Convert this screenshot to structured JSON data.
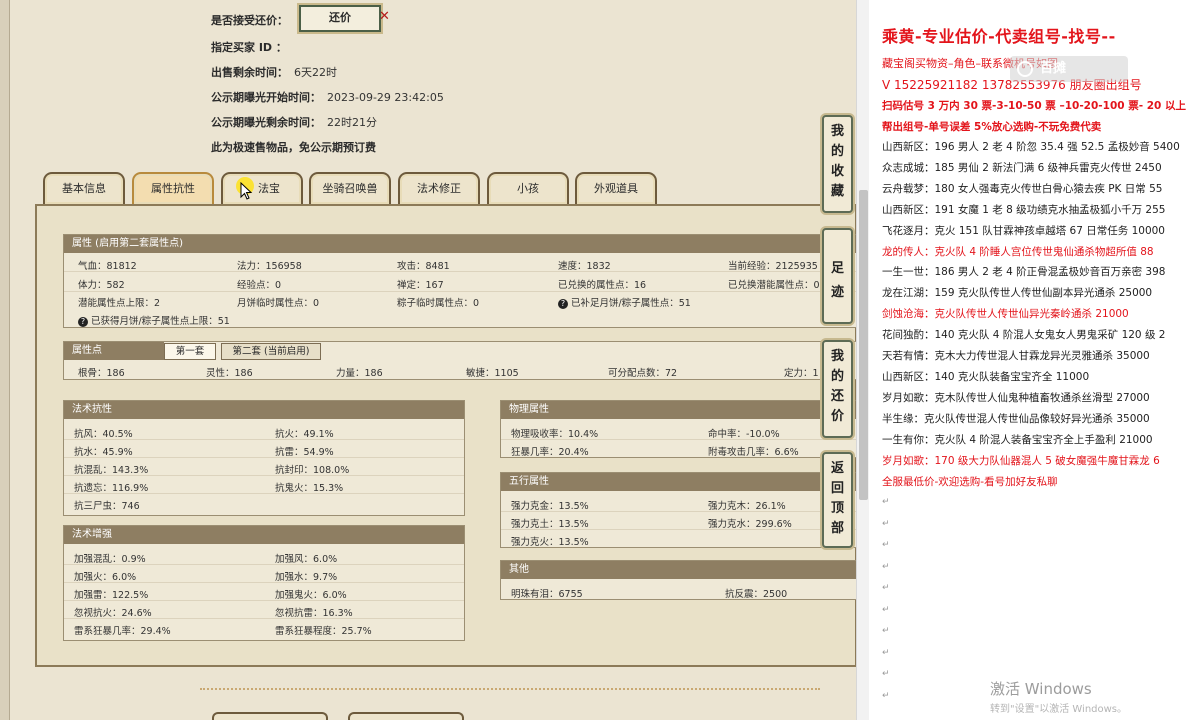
{
  "info": {
    "accept_label": "是否接受还价：",
    "counter_button": "还价",
    "buyer_label": "指定买家 ID ：",
    "remain_label": "出售剩余时间：",
    "remain_value": "6天22时",
    "pub_start_label": "公示期曝光开始时间：",
    "pub_start_value": "2023-09-29 23:42:05",
    "pub_remain_label": "公示期曝光剩余时间：",
    "pub_remain_value": "22时21分",
    "note": "此为极速售物品，免公示期预订费"
  },
  "tabs": [
    "基本信息",
    "属性抗性",
    "法宝",
    "坐骑召唤兽",
    "法术修正",
    "小孩",
    "外观道具"
  ],
  "attr": {
    "header": "属性 (启用第二套属性点)",
    "r1": [
      "气血：81812",
      "法力：156958",
      "攻击：8481",
      "速度：1832",
      "当前经验：2125935"
    ],
    "r2": [
      "体力：582",
      "经验点：0",
      "禅定：167",
      "已兑换的属性点：16",
      "已兑换潜能属性点：0"
    ],
    "r3": [
      "潜能属性点上限：2",
      "月饼临时属性点：0",
      "粽子临时属性点：0",
      "已补足月饼/粽子属性点：51"
    ],
    "r4": "已获得月饼/粽子属性点上限：51"
  },
  "points": {
    "header": "属性点",
    "tab1": "第一套",
    "tab2": "第二套 (当前启用)",
    "row": [
      "根骨：186",
      "灵性：186",
      "力量：186",
      "敏捷：1105",
      "可分配点数：72",
      "定力：1"
    ]
  },
  "spell_res": {
    "header": "法术抗性",
    "cells": [
      [
        "抗风：40.5%",
        "抗火：49.1%"
      ],
      [
        "抗水：45.9%",
        "抗雷：54.9%"
      ],
      [
        "抗混乱：143.3%",
        "抗封印：108.0%"
      ],
      [
        "抗遗忘：116.9%",
        "抗鬼火：15.3%"
      ],
      [
        "抗三尸虫：746",
        ""
      ]
    ]
  },
  "spell_boost": {
    "header": "法术增强",
    "cells": [
      [
        "加强混乱：0.9%",
        "加强风：6.0%"
      ],
      [
        "加强火：6.0%",
        "加强水：9.7%"
      ],
      [
        "加强雷：122.5%",
        "加强鬼火：6.0%"
      ],
      [
        "忽视抗火：24.6%",
        "忽视抗雷：16.3%"
      ],
      [
        "雷系狂暴几率：29.4%",
        "雷系狂暴程度：25.7%"
      ]
    ]
  },
  "physical": {
    "header": "物理属性",
    "cells": [
      [
        "物理吸收率：10.4%",
        "命中率：-10.0%"
      ],
      [
        "狂暴几率：20.4%",
        "附毒攻击几率：6.6%"
      ]
    ]
  },
  "five": {
    "header": "五行属性",
    "cells": [
      [
        "强力克金：13.5%",
        "强力克木：26.1%"
      ],
      [
        "强力克土：13.5%",
        "强力克水：299.6%"
      ],
      [
        "强力克火：13.5%",
        ""
      ]
    ]
  },
  "other": {
    "header": "其他",
    "cells": [
      [
        "明珠有泪：6755",
        "抗反震：2500"
      ]
    ]
  },
  "side_buttons": [
    "我的收藏",
    "足迹",
    "我的还价",
    "返回顶部"
  ],
  "doc": {
    "title": "乘黄-专业估价-代卖组号-找号--",
    "l1": "藏宝阁买物资–角色–联系微机号如图–",
    "l2": "V 15225921182   13782553976 朋友圈出组号",
    "l3": "扫码估号 3 万内 30 票-3-10-50 票 –10-20-100 票- 20 以上",
    "l4": "帮出组号-单号误差 5%放心选购-不玩免费代卖",
    "lines": [
      {
        "t": "山西新区：196 男人 2 老 4 阶忽 35.4 强 52.5 孟极妙音 5400",
        "red": false
      },
      {
        "t": "众志成城：185 男仙 2 新法门满 6 级神兵雷克火传世 2450",
        "red": false
      },
      {
        "t": "云舟载梦：180 女人强毒克火传世白骨心猿去疾 PK 日常 55",
        "red": false
      },
      {
        "t": "山西新区：191 女魔 1 老 8 级功绩克水抽孟极狐小千万 255",
        "red": false
      },
      {
        "t": "飞花逐月：克火 151 队甘霖神孩卓越塔 67 日常任务 10000",
        "red": false
      },
      {
        "t": "龙的传人：克火队 4 阶睡人宫位传世鬼仙通杀物超所值 88",
        "red": true
      },
      {
        "t": "一生一世：186 男人 2 老 4 阶正骨混孟极妙音百万亲密 398",
        "red": false
      },
      {
        "t": "龙在江湖：159 克火队传世人传世仙副本异光通杀 25000",
        "red": false
      },
      {
        "t": "剑蚀沧海：克火队传世人传世仙异光秦岭通杀 21000",
        "red": true
      },
      {
        "t": "花间独酌：140 克火队 4 阶混人女鬼女人男鬼采矿 120 级 2",
        "red": false
      },
      {
        "t": "天若有情：克木大力传世混人甘霖龙异光灵雅通杀 35000",
        "red": false
      },
      {
        "t": "山西新区：140 克火队装备宝宝齐全 11000",
        "red": false
      },
      {
        "t": "岁月如歌：克木队传世人仙鬼种植畜牧通杀丝滑型 27000",
        "red": false
      },
      {
        "t": "半生缘：克火队传世混人传世仙品像较好异光通杀 35000",
        "red": false
      },
      {
        "t": "一生有你：克火队 4 阶混人装备宝宝齐全上手盈利 21000",
        "red": false
      },
      {
        "t": "岁月如歌：170 级大力队仙器混人 5 破女魔强牛魔甘霖龙 6",
        "red": true
      }
    ],
    "footer": "全服最低价-欢迎选购-看号加好友私聊",
    "logo": "百摊",
    "wm1": "激活 Windows",
    "wm2": "转到\"设置\"以激活 Windows。"
  }
}
